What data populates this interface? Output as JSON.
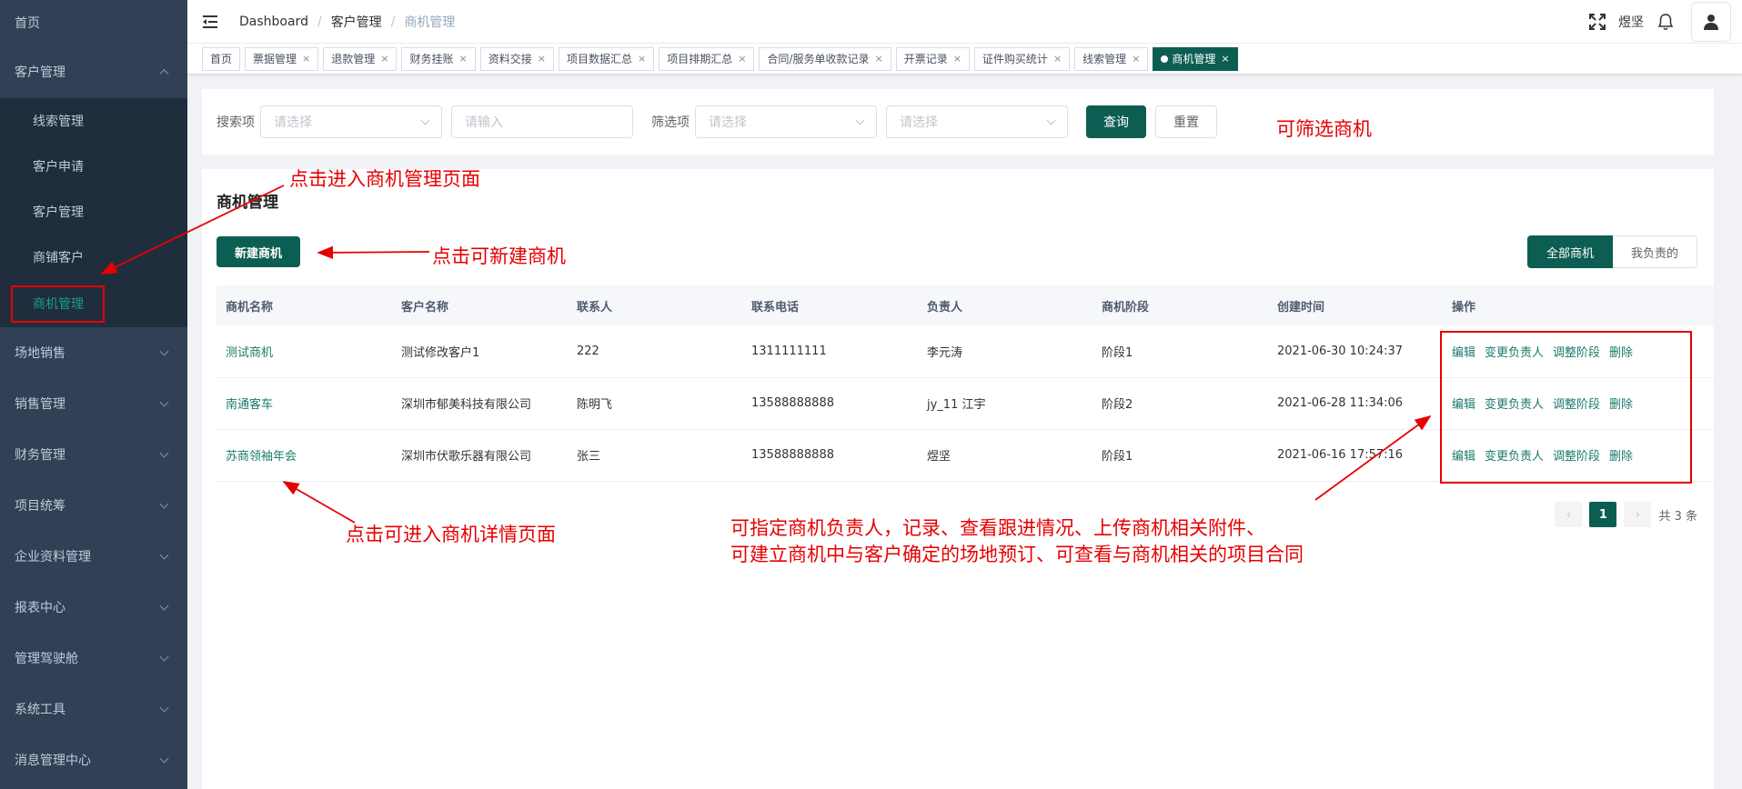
{
  "sidebar": {
    "items": [
      {
        "label": "首页"
      },
      {
        "label": "客户管理"
      },
      {
        "label": "场地销售"
      },
      {
        "label": "销售管理"
      },
      {
        "label": "财务管理"
      },
      {
        "label": "项目统筹"
      },
      {
        "label": "企业资料管理"
      },
      {
        "label": "报表中心"
      },
      {
        "label": "管理驾驶舱"
      },
      {
        "label": "系统工具"
      },
      {
        "label": "消息管理中心"
      }
    ],
    "subitems": [
      {
        "label": "线索管理"
      },
      {
        "label": "客户申请"
      },
      {
        "label": "客户管理"
      },
      {
        "label": "商铺客户"
      },
      {
        "label": "商机管理"
      }
    ]
  },
  "navbar": {
    "breadcrumb": [
      "Dashboard",
      "客户管理",
      "商机管理"
    ],
    "separator": "/",
    "user_name": "煜坚"
  },
  "tags": [
    {
      "label": "首页"
    },
    {
      "label": "票据管理"
    },
    {
      "label": "退款管理"
    },
    {
      "label": "财务挂账"
    },
    {
      "label": "资料交接"
    },
    {
      "label": "项目数据汇总"
    },
    {
      "label": "项目排期汇总"
    },
    {
      "label": "合同/服务单收款记录"
    },
    {
      "label": "开票记录"
    },
    {
      "label": "证件购买统计"
    },
    {
      "label": "线索管理"
    },
    {
      "label": "商机管理"
    }
  ],
  "tag_close": "×",
  "search": {
    "label1": "搜索项",
    "select1_placeholder": "请选择",
    "input_placeholder": "请输入",
    "label2": "筛选项",
    "select2_placeholder": "请选择",
    "select3_placeholder": "请选择",
    "query_button": "查询",
    "reset_button": "重置"
  },
  "main": {
    "title": "商机管理",
    "new_button": "新建商机",
    "tab_all": "全部商机",
    "tab_mine": "我负责的",
    "columns": [
      "商机名称",
      "客户名称",
      "联系人",
      "联系电话",
      "负责人",
      "商机阶段",
      "创建时间",
      "操作"
    ],
    "rows": [
      [
        "测试商机",
        "测试修改客户1",
        "222",
        "1311111111",
        "李元涛",
        "阶段1",
        "2021-06-30 10:24:37"
      ],
      [
        "南通客车",
        "深圳市郁美科技有限公司",
        "陈明飞",
        "13588888888",
        "jy_11 江宇",
        "阶段2",
        "2021-06-28 11:34:06"
      ],
      [
        "苏商领袖年会",
        "深圳市伏歌乐器有限公司",
        "张三",
        "13588888888",
        "煜坚",
        "阶段1",
        "2021-06-16 17:57:16"
      ]
    ],
    "ops": [
      "编辑",
      "变更负责人",
      "调整阶段",
      "删除"
    ]
  },
  "pager": {
    "prev": "‹",
    "current": "1",
    "next": "›",
    "total": "共 3 条"
  },
  "annotations": {
    "filter": "可筛选商机",
    "enter_page": "点击进入商机管理页面",
    "new": "点击可新建商机",
    "detail": "点击可进入商机详情页面",
    "ops_line1": "可指定商机负责人，记录、查看跟进情况、上传商机相关附件、",
    "ops_line2": "可建立商机中与客户确定的场地预订、可查看与商机相关的项目合同"
  },
  "colors": {
    "sidebar_bg": "#304156",
    "primary": "#0d5e52",
    "annotation": "#e60000"
  }
}
